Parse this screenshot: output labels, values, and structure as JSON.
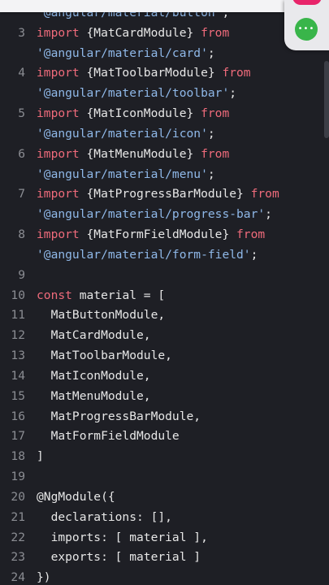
{
  "editor": {
    "lines": [
      {
        "num": "",
        "segments": [
          {
            "t": "'@angular/material/button'",
            "c": "str"
          },
          {
            "t": ";",
            "c": "dec"
          }
        ]
      },
      {
        "num": "3",
        "segments": [
          {
            "t": "import",
            "c": "kw"
          },
          {
            "t": " {MatCardModule} ",
            "c": "dec"
          },
          {
            "t": "from",
            "c": "kw"
          }
        ]
      },
      {
        "num": "",
        "segments": [
          {
            "t": "'@angular/material/card'",
            "c": "str"
          },
          {
            "t": ";",
            "c": "dec"
          }
        ]
      },
      {
        "num": "4",
        "segments": [
          {
            "t": "import",
            "c": "kw"
          },
          {
            "t": " {MatToolbarModule} ",
            "c": "dec"
          },
          {
            "t": "from",
            "c": "kw"
          }
        ]
      },
      {
        "num": "",
        "segments": [
          {
            "t": "'@angular/material/toolbar'",
            "c": "str"
          },
          {
            "t": ";",
            "c": "dec"
          }
        ]
      },
      {
        "num": "5",
        "segments": [
          {
            "t": "import",
            "c": "kw"
          },
          {
            "t": " {MatIconModule} ",
            "c": "dec"
          },
          {
            "t": "from",
            "c": "kw"
          }
        ]
      },
      {
        "num": "",
        "segments": [
          {
            "t": "'@angular/material/icon'",
            "c": "str"
          },
          {
            "t": ";",
            "c": "dec"
          }
        ]
      },
      {
        "num": "6",
        "segments": [
          {
            "t": "import",
            "c": "kw"
          },
          {
            "t": " {MatMenuModule} ",
            "c": "dec"
          },
          {
            "t": "from",
            "c": "kw"
          }
        ]
      },
      {
        "num": "",
        "segments": [
          {
            "t": "'@angular/material/menu'",
            "c": "str"
          },
          {
            "t": ";",
            "c": "dec"
          }
        ]
      },
      {
        "num": "7",
        "segments": [
          {
            "t": "import",
            "c": "kw"
          },
          {
            "t": " {MatProgressBarModule} ",
            "c": "dec"
          },
          {
            "t": "from",
            "c": "kw"
          }
        ]
      },
      {
        "num": "",
        "segments": [
          {
            "t": "'@angular/material/progress-bar'",
            "c": "str"
          },
          {
            "t": ";",
            "c": "dec"
          }
        ]
      },
      {
        "num": "8",
        "segments": [
          {
            "t": "import",
            "c": "kw"
          },
          {
            "t": " {MatFormFieldModule} ",
            "c": "dec"
          },
          {
            "t": "from",
            "c": "kw"
          }
        ]
      },
      {
        "num": "",
        "segments": [
          {
            "t": "'@angular/material/form-field'",
            "c": "str"
          },
          {
            "t": ";",
            "c": "dec"
          }
        ]
      },
      {
        "num": "9",
        "segments": []
      },
      {
        "num": "10",
        "segments": [
          {
            "t": "const",
            "c": "kw"
          },
          {
            "t": " material = [",
            "c": "dec"
          }
        ]
      },
      {
        "num": "11",
        "segments": [
          {
            "t": "  MatButtonModule,",
            "c": "dec"
          }
        ]
      },
      {
        "num": "12",
        "segments": [
          {
            "t": "  MatCardModule,",
            "c": "dec"
          }
        ]
      },
      {
        "num": "13",
        "segments": [
          {
            "t": "  MatToolbarModule,",
            "c": "dec"
          }
        ]
      },
      {
        "num": "14",
        "segments": [
          {
            "t": "  MatIconModule,",
            "c": "dec"
          }
        ]
      },
      {
        "num": "15",
        "segments": [
          {
            "t": "  MatMenuModule,",
            "c": "dec"
          }
        ]
      },
      {
        "num": "16",
        "segments": [
          {
            "t": "  MatProgressBarModule,",
            "c": "dec"
          }
        ]
      },
      {
        "num": "17",
        "segments": [
          {
            "t": "  MatFormFieldModule",
            "c": "dec"
          }
        ]
      },
      {
        "num": "18",
        "segments": [
          {
            "t": "]",
            "c": "dec"
          }
        ]
      },
      {
        "num": "19",
        "segments": []
      },
      {
        "num": "20",
        "segments": [
          {
            "t": "@NgModule({",
            "c": "dec"
          }
        ]
      },
      {
        "num": "21",
        "segments": [
          {
            "t": "  declarations: [],",
            "c": "dec"
          }
        ]
      },
      {
        "num": "22",
        "segments": [
          {
            "t": "  imports: [ material ],",
            "c": "dec"
          }
        ]
      },
      {
        "num": "23",
        "segments": [
          {
            "t": "  exports: [ material ]",
            "c": "dec"
          }
        ]
      },
      {
        "num": "24",
        "segments": [
          {
            "t": "})",
            "c": "dec"
          }
        ]
      }
    ]
  },
  "floating_button": {
    "icon": "more-horizontal-icon",
    "glyph": "•••",
    "color": "#39b54a"
  },
  "colors": {
    "background": "#1e1f25",
    "keyword": "#ef6b7b",
    "string": "#8fb8e8",
    "default_text": "#e6e6e6",
    "line_number": "#8b8d93"
  }
}
